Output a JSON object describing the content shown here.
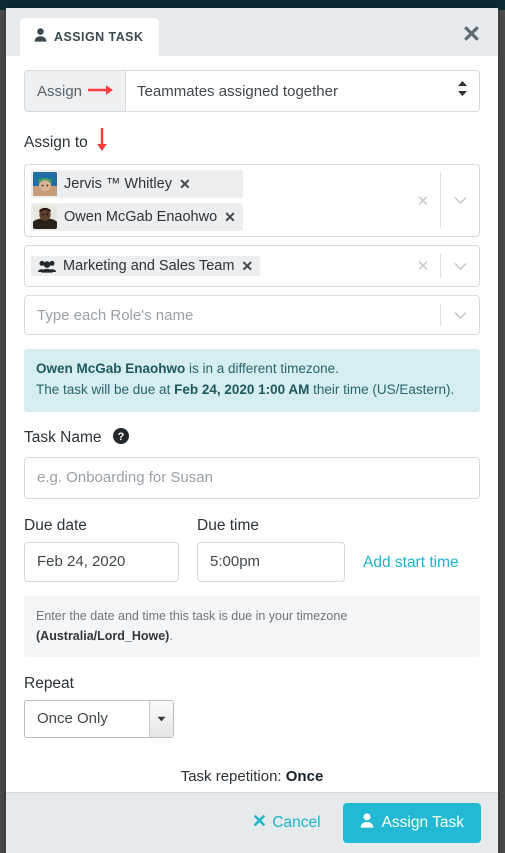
{
  "window": {
    "close_icon": "close-x-icon"
  },
  "tab": {
    "icon": "person-icon",
    "label": "ASSIGN TASK"
  },
  "assign_row": {
    "addon_label": "Assign",
    "addon_arrow_icon": "arrow-right-icon",
    "selected_option": "Teammates assigned together",
    "options": [
      "Teammates assigned together"
    ],
    "caret_icon": "select-updown-icon"
  },
  "assign_to": {
    "label": "Assign to",
    "arrow_icon": "arrow-down-icon",
    "members": [
      {
        "name": "Jervis ™ Whitley",
        "avatar": "avatar-jervis",
        "remove_icon": "remove-x-icon"
      },
      {
        "name": "Owen McGab Enaohwo",
        "avatar": "avatar-owen",
        "remove_icon": "remove-x-icon"
      }
    ],
    "members_clear_icon": "clear-x-icon",
    "members_caret_icon": "chevron-down-icon",
    "groups": [
      {
        "name": "Marketing and Sales Team",
        "icon": "users-group-icon",
        "remove_icon": "remove-x-icon"
      }
    ],
    "groups_clear_icon": "clear-x-icon",
    "groups_caret_icon": "chevron-down-icon",
    "roles_placeholder": "Type each Role's name",
    "roles_caret_icon": "chevron-down-icon"
  },
  "timezone_alert": {
    "person": "Owen McGab Enaohwo",
    "text_1": " is in a different timezone.",
    "text_2": "The task will be due at ",
    "due_datetime": "Feb 24, 2020 1:00 AM",
    "text_3": " their time (US/Eastern)."
  },
  "task_name": {
    "label": "Task Name",
    "help_icon": "question-circle-icon",
    "value": "",
    "placeholder": "e.g. Onboarding for Susan"
  },
  "due": {
    "date_label": "Due date",
    "date_value": "Feb 24, 2020",
    "time_label": "Due time",
    "time_value": "5:00pm",
    "add_start_time_link": "Add start time"
  },
  "timezone_note": {
    "text_1": "Enter the date and time this task is due in your timezone ",
    "timezone": "(Australia/Lord_Howe)",
    "text_2": "."
  },
  "repeat": {
    "label": "Repeat",
    "selected_option": "Once Only",
    "options": [
      "Once Only"
    ],
    "caret_icon": "select-down-icon",
    "repetition_prefix": "Task repetition: ",
    "repetition_value": "Once"
  },
  "footer": {
    "cancel_icon": "x-icon",
    "cancel_label": "Cancel",
    "submit_icon": "person-icon",
    "submit_label": "Assign Task"
  },
  "colors": {
    "accent": "#21b9d4",
    "link": "#19b5cd",
    "alert_bg": "#d6eef1",
    "alert_text": "#27646b",
    "annotation_red": "#fa3c3c",
    "header_bg": "#e7eaec"
  }
}
